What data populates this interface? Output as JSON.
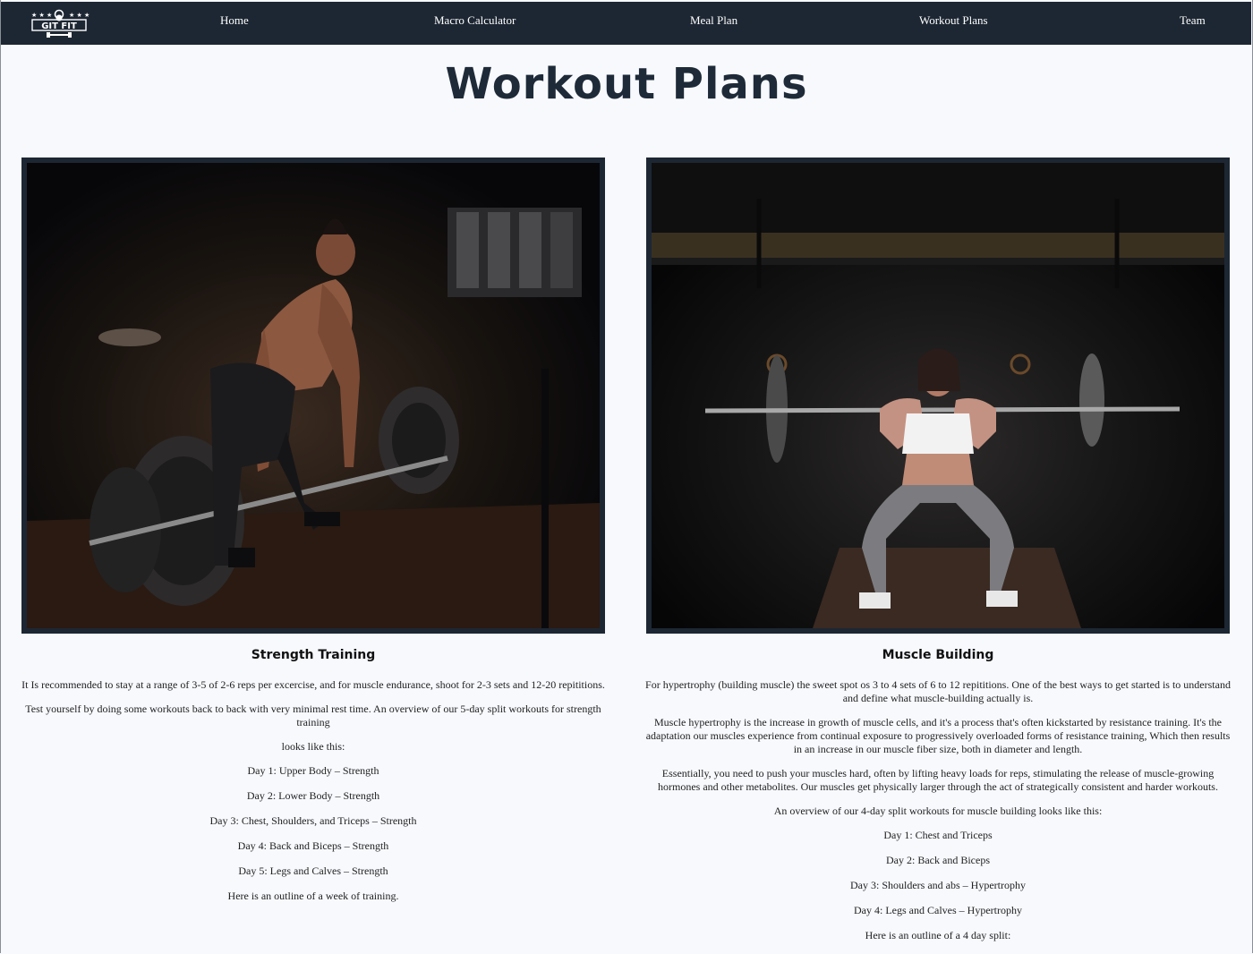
{
  "nav": {
    "logo_text": "GIT FIT",
    "links": [
      "Home",
      "Macro Calculator",
      "Meal Plan",
      "Workout Plans",
      "Team"
    ]
  },
  "page": {
    "title": "Workout Plans"
  },
  "cards": [
    {
      "title": "Strength Training",
      "paragraphs": [
        "It Is recommended to stay at a range of 3-5 of 2-6 reps per excercise, and for muscle endurance, shoot for 2-3 sets and 12-20 repititions.",
        "Test yourself by doing some workouts back to back with very minimal rest time. An overview of our 5-day split workouts for strength training",
        "looks like this:"
      ],
      "days": [
        "Day 1: Upper Body – Strength",
        "Day 2: Lower Body – Strength",
        "Day 3: Chest, Shoulders, and Triceps – Strength",
        "Day 4: Back and Biceps – Strength",
        "Day 5: Legs and Calves – Strength"
      ],
      "outro": "Here is an outline of a week of training."
    },
    {
      "title": "Muscle Building",
      "paragraphs": [
        "For hypertrophy (building muscle) the sweet spot os 3 to 4 sets of 6 to 12 repititions. One of the best ways to get started is to understand and define what muscle-building actually is.",
        "Muscle hypertrophy is the increase in growth of muscle cells, and it's a process that's often kickstarted by resistance training. It's the adaptation our muscles experience from continual exposure to progressively overloaded forms of resistance training, Which then results in an increase in our muscle fiber size, both in diameter and length.",
        "Essentially, you need to push your muscles hard, often by lifting heavy loads for reps, stimulating the release of muscle-growing hormones and other metabolites. Our muscles get physically larger through the act of strategically consistent and harder workouts.",
        "An overview of our 4-day split workouts for muscle building looks like this:"
      ],
      "days": [
        "Day 1: Chest and Triceps",
        "Day 2: Back and Biceps",
        "Day 3: Shoulders and abs – Hypertrophy",
        "Day 4: Legs and Calves – Hypertrophy"
      ],
      "outro": "Here is an outline of a 4 day split:"
    }
  ],
  "colors": {
    "nav_bg": "#1d2733",
    "page_bg": "#f7f9fd",
    "title": "#1e2a38",
    "photo_border": "#1d2733"
  }
}
